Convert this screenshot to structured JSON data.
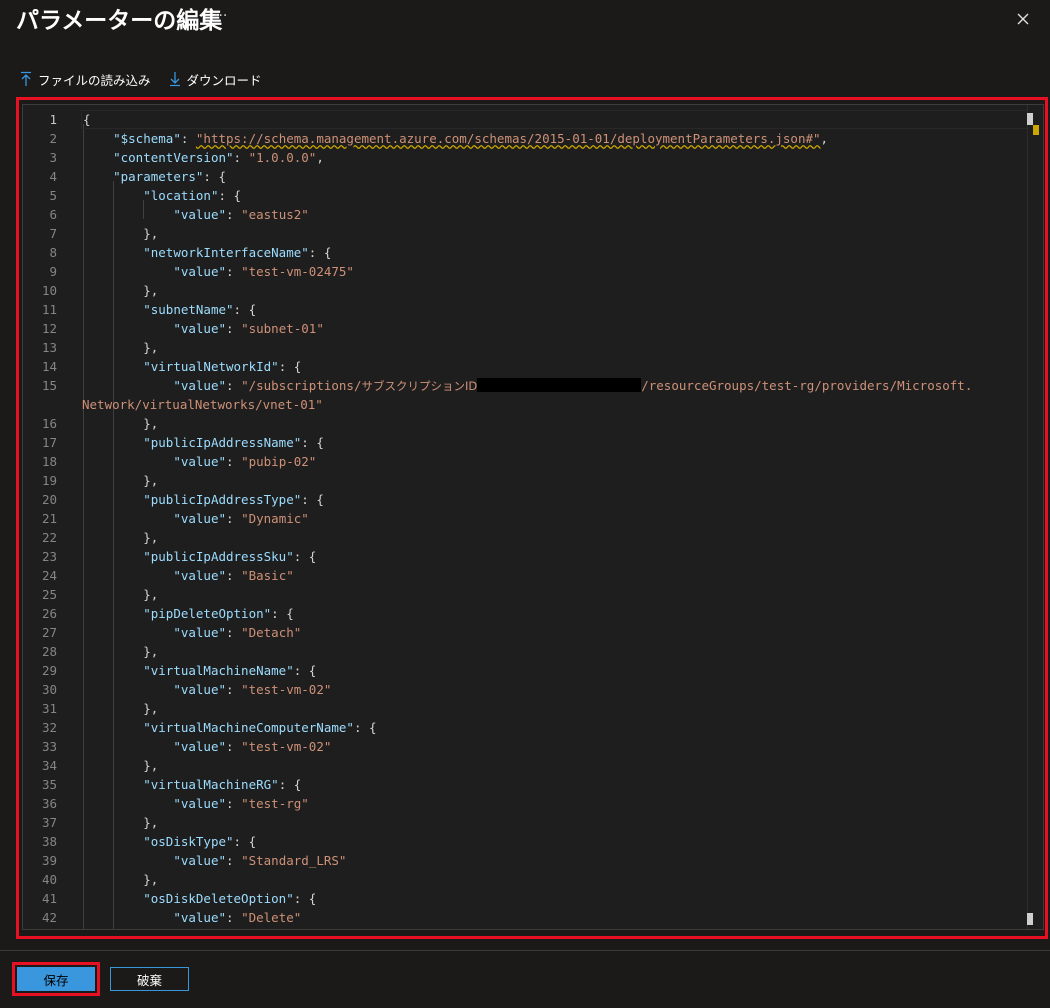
{
  "header": {
    "title": "パラメーターの編集",
    "more": "···"
  },
  "toolbar": {
    "upload_label": "ファイルの読み込み",
    "download_label": "ダウンロード"
  },
  "editor": {
    "line_numbers": [
      "1",
      "2",
      "3",
      "4",
      "5",
      "6",
      "7",
      "8",
      "9",
      "10",
      "11",
      "12",
      "13",
      "14",
      "15",
      "16",
      "17",
      "18",
      "19",
      "20",
      "21",
      "22",
      "23",
      "24",
      "25",
      "26",
      "27",
      "28",
      "29",
      "30",
      "31",
      "32",
      "33",
      "34",
      "35",
      "36",
      "37",
      "38",
      "39",
      "40",
      "41",
      "42"
    ],
    "l1": "{",
    "l2_key": "\"$schema\"",
    "l2_val": "\"https://schema.management.azure.com/schemas/2015-01-01/deploymentParameters.json#\"",
    "l3_key": "\"contentVersion\"",
    "l3_val": "\"1.0.0.0\"",
    "l4_key": "\"parameters\"",
    "l5_key": "\"location\"",
    "l6_val": "\"eastus2\"",
    "l8_key": "\"networkInterfaceName\"",
    "l9_val": "\"test-vm-02475\"",
    "l11_key": "\"subnetName\"",
    "l12_val": "\"subnet-01\"",
    "l14_key": "\"virtualNetworkId\"",
    "l15_val_a": "\"/subscriptions/",
    "l15_sub_label": "サブスクリプションID",
    "l15_val_b": "/resourceGroups/test-rg/providers/Microsoft.",
    "l15_cont": "Network/virtualNetworks/vnet-01\"",
    "l17_key": "\"publicIpAddressName\"",
    "l18_val": "\"pubip-02\"",
    "l20_key": "\"publicIpAddressType\"",
    "l21_val": "\"Dynamic\"",
    "l23_key": "\"publicIpAddressSku\"",
    "l24_val": "\"Basic\"",
    "l26_key": "\"pipDeleteOption\"",
    "l27_val": "\"Detach\"",
    "l29_key": "\"virtualMachineName\"",
    "l30_val": "\"test-vm-02\"",
    "l32_key": "\"virtualMachineComputerName\"",
    "l33_val": "\"test-vm-02\"",
    "l35_key": "\"virtualMachineRG\"",
    "l36_val": "\"test-rg\"",
    "l38_key": "\"osDiskType\"",
    "l39_val": "\"Standard_LRS\"",
    "l41_key": "\"osDiskDeleteOption\"",
    "l42_val": "\"Delete\"",
    "value_key": "\"value\""
  },
  "footer": {
    "save_label": "保存",
    "discard_label": "破棄"
  },
  "colors": {
    "accent": "#3a96dd",
    "highlight_frame": "#e81123",
    "json_key": "#9cdcfe",
    "json_string": "#ce9178"
  }
}
